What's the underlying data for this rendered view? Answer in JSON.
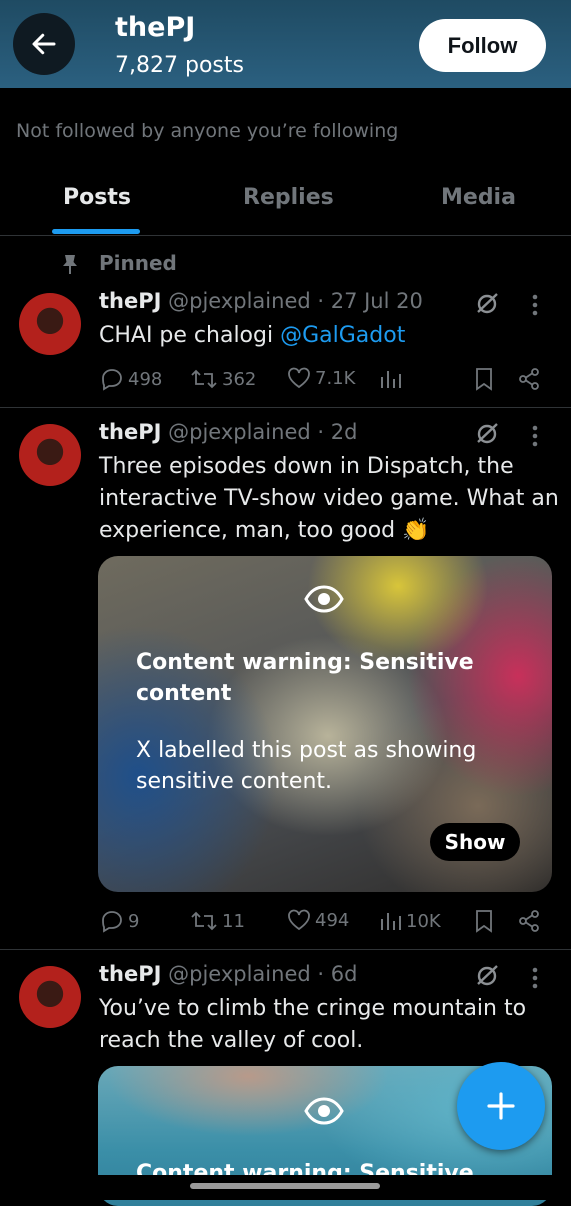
{
  "header": {
    "name": "thePJ",
    "posts_count": "7,827 posts",
    "follow_label": "Follow"
  },
  "not_followed_text": "Not followed by anyone you’re following",
  "tabs": [
    {
      "label": "Posts",
      "active": true
    },
    {
      "label": "Replies",
      "active": false
    },
    {
      "label": "Media",
      "active": false
    }
  ],
  "pinned_label": "Pinned",
  "posts": [
    {
      "name": "thePJ",
      "meta": "@pjexplained · 27 Jul 20",
      "text_prefix": "CHAI pe chalogi ",
      "mention": "@GalGadot",
      "replies": "498",
      "reposts": "362",
      "likes": "7.1K",
      "views": ""
    },
    {
      "name": "thePJ",
      "meta": "@pjexplained · 2d",
      "text": "Three episodes down in Dispatch, the interactive TV-show video game. What an experience, man, too good 👏",
      "content_warning": {
        "title": "Content warning: Sensitive content",
        "subtitle": "X labelled this post as showing sensitive content.",
        "show_label": "Show"
      },
      "replies": "9",
      "reposts": "11",
      "likes": "494",
      "views": "10K"
    },
    {
      "name": "thePJ",
      "meta": "@pjexplained · 6d",
      "text": "You’ve to climb the cringe mountain to reach the valley of cool.",
      "content_warning": {
        "title": "Content warning: Sensitive"
      }
    }
  ],
  "icons": {
    "back": "arrow-left-icon",
    "pin": "pin-icon",
    "grok": "grok-icon",
    "more": "more-vertical-icon",
    "reply": "reply-icon",
    "repost": "repost-icon",
    "like": "heart-icon",
    "views": "views-icon",
    "bookmark": "bookmark-icon",
    "share": "share-icon",
    "eye": "eye-icon",
    "compose": "plus-icon"
  },
  "colors": {
    "accent": "#1d9bf0",
    "background": "#000000",
    "header": "#2b6080",
    "secondary_text": "#71767b"
  }
}
